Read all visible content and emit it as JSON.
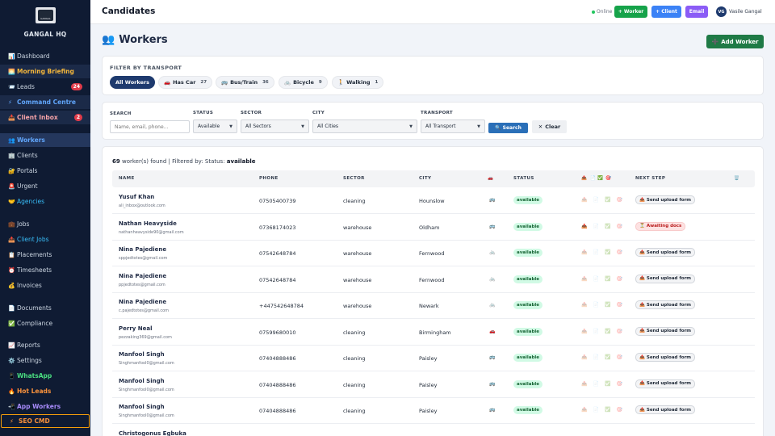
{
  "sidebar": {
    "brand": "GANGAL HQ",
    "logo_text": "GANGAL",
    "items": [
      {
        "label": "Dashboard",
        "icon": "📊",
        "name": "sidebar-item-dashboard"
      },
      {
        "label": "Morning Briefing",
        "icon": "🌅",
        "name": "sidebar-item-morning-briefing"
      },
      {
        "label": "Leads",
        "icon": "📨",
        "badge": "24",
        "name": "sidebar-item-leads"
      },
      {
        "label": "Command Centre",
        "icon": "⚡",
        "name": "sidebar-item-command-centre"
      },
      {
        "label": "Client Inbox",
        "icon": "📥",
        "badge": "2",
        "name": "sidebar-item-client-inbox"
      },
      {
        "label": "Workers",
        "icon": "👥",
        "name": "sidebar-item-workers"
      },
      {
        "label": "Clients",
        "icon": "🏢",
        "name": "sidebar-item-clients"
      },
      {
        "label": "Portals",
        "icon": "🔐",
        "name": "sidebar-item-portals"
      },
      {
        "label": "Urgent",
        "icon": "🚨",
        "name": "sidebar-item-urgent"
      },
      {
        "label": "Agencies",
        "icon": "🤝",
        "name": "sidebar-item-agencies"
      },
      {
        "label": "Jobs",
        "icon": "💼",
        "name": "sidebar-item-jobs"
      },
      {
        "label": "Client Jobs",
        "icon": "📤",
        "name": "sidebar-item-client-jobs"
      },
      {
        "label": "Placements",
        "icon": "📋",
        "name": "sidebar-item-placements"
      },
      {
        "label": "Timesheets",
        "icon": "⏰",
        "name": "sidebar-item-timesheets"
      },
      {
        "label": "Invoices",
        "icon": "💰",
        "name": "sidebar-item-invoices"
      },
      {
        "label": "Documents",
        "icon": "📄",
        "name": "sidebar-item-documents"
      },
      {
        "label": "Compliance",
        "icon": "✅",
        "name": "sidebar-item-compliance"
      },
      {
        "label": "Reports",
        "icon": "📈",
        "name": "sidebar-item-reports"
      },
      {
        "label": "Settings",
        "icon": "⚙️",
        "name": "sidebar-item-settings"
      },
      {
        "label": "WhatsApp",
        "icon": "📱",
        "name": "sidebar-item-whatsapp"
      },
      {
        "label": "Hot Leads",
        "icon": "🔥",
        "name": "sidebar-item-hot-leads"
      },
      {
        "label": "App Workers",
        "icon": "📲",
        "name": "sidebar-item-app-workers"
      },
      {
        "label": "SEO CMD",
        "icon": "⚡",
        "name": "sidebar-item-seo-cmd"
      }
    ]
  },
  "topbar": {
    "title": "Candidates",
    "online": "Online",
    "worker_btn": "+ Worker",
    "client_btn": "+ Client",
    "email_btn": "Email",
    "avatar": "VG",
    "user_name": "Vasile Gangal"
  },
  "heading": {
    "icon": "👥",
    "title": "Workers",
    "add_button": "Add Worker",
    "add_icon": "➕"
  },
  "transport": {
    "label": "FILTER BY TRANSPORT",
    "pills": [
      {
        "label": "All Workers",
        "icon": "",
        "count": ""
      },
      {
        "label": "Has Car",
        "icon": "🚗",
        "count": "27"
      },
      {
        "label": "Bus/Train",
        "icon": "🚌",
        "count": "36"
      },
      {
        "label": "Bicycle",
        "icon": "🚲",
        "count": "9"
      },
      {
        "label": "Walking",
        "icon": "🚶",
        "count": "1"
      }
    ]
  },
  "filters": {
    "search_label": "SEARCH",
    "search_placeholder": "Name, email, phone...",
    "status_label": "STATUS",
    "status_value": "Available",
    "sector_label": "SECTOR",
    "sector_value": "All Sectors",
    "city_label": "CITY",
    "city_value": "All Cities",
    "transport_label": "TRANSPORT",
    "transport_value": "All Transport",
    "search_btn": "Search",
    "search_icon": "🔍",
    "clear_btn": "Clear",
    "clear_icon": "✕"
  },
  "results": {
    "count": "69",
    "text": "worker(s) found | Filtered by: Status:",
    "filter_value": "available"
  },
  "table": {
    "headers": {
      "name": "NAME",
      "phone": "PHONE",
      "sector": "SECTOR",
      "city": "CITY",
      "transport": "🚗",
      "status": "STATUS",
      "docs": [
        "📤",
        "📄",
        "✅",
        "🎯"
      ],
      "next": "NEXT STEP",
      "actions": "🗑️"
    },
    "rows": [
      {
        "name": "Yusuf Khan",
        "email": "ali_inbox@outlook.com",
        "phone": "07505400739",
        "sector": "cleaning",
        "city": "Hounslow",
        "transport": "🚌",
        "status": "available",
        "next": "Send upload form",
        "next_icon": "📤",
        "await": false
      },
      {
        "name": "Nathan Heavyside",
        "email": "nathanheavyside90@gmail.com",
        "phone": "07368174023",
        "sector": "warehouse",
        "city": "Oldham",
        "transport": "🚌",
        "status": "available",
        "next": "Awaiting docs",
        "next_icon": "⏳",
        "await": true
      },
      {
        "name": "Nina Pajediene",
        "email": "sppjedtotes@gmail.com",
        "phone": "07542648784",
        "sector": "warehouse",
        "city": "Fernwood",
        "transport": "🚲",
        "status": "available",
        "next": "Send upload form",
        "next_icon": "📤",
        "await": false
      },
      {
        "name": "Nina Pajediene",
        "email": "ppjedtotes@gmail.com",
        "phone": "07542648784",
        "sector": "warehouse",
        "city": "Fernwood",
        "transport": "🚲",
        "status": "available",
        "next": "Send upload form",
        "next_icon": "📤",
        "await": false
      },
      {
        "name": "Nina Pajediene",
        "email": "c.pajedtotes@gmail.com",
        "phone": "+447542648784",
        "sector": "warehouse",
        "city": "Newark",
        "transport": "🚲",
        "status": "available",
        "next": "Send upload form",
        "next_icon": "📤",
        "await": false
      },
      {
        "name": "Perry Neal",
        "email": "pezzaking369@gmail.com",
        "phone": "07599680010",
        "sector": "cleaning",
        "city": "Birmingham",
        "transport": "🚗",
        "status": "available",
        "next": "Send upload form",
        "next_icon": "📤",
        "await": false
      },
      {
        "name": "Manfool Singh",
        "email": "Singhmanfool0@gmail.com",
        "phone": "07404888486",
        "sector": "cleaning",
        "city": "Paisley",
        "transport": "🚌",
        "status": "available",
        "next": "Send upload form",
        "next_icon": "📤",
        "await": false
      },
      {
        "name": "Manfool Singh",
        "email": "Singhmanfool0@gmail.com",
        "phone": "07404888486",
        "sector": "cleaning",
        "city": "Paisley",
        "transport": "🚌",
        "status": "available",
        "next": "Send upload form",
        "next_icon": "📤",
        "await": false
      },
      {
        "name": "Manfool Singh",
        "email": "Singhmanfool0@gmail.com",
        "phone": "07404888486",
        "sector": "cleaning",
        "city": "Paisley",
        "transport": "🚌",
        "status": "available",
        "next": "Send upload form",
        "next_icon": "📤",
        "await": false
      },
      {
        "name": "Christogonus Egbuka",
        "email": "",
        "phone": "",
        "sector": "",
        "city": "",
        "transport": "",
        "status": "",
        "next": "",
        "next_icon": "",
        "await": false
      }
    ]
  }
}
